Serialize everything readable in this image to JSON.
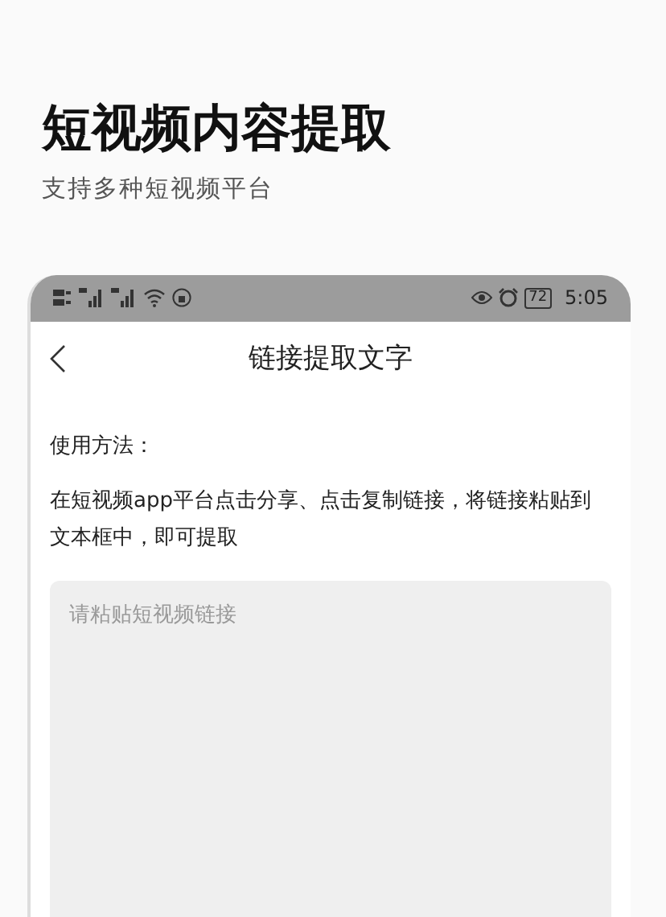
{
  "header": {
    "title": "短视频内容提取",
    "subtitle": "支持多种短视频平台"
  },
  "status_bar": {
    "battery": "72",
    "time": "5:05"
  },
  "nav_bar": {
    "title": "链接提取文字"
  },
  "usage": {
    "label": "使用方法：",
    "text": "在短视频app平台点击分享、点击复制链接，将链接粘贴到文本框中，即可提取"
  },
  "link_field": {
    "placeholder": "请粘贴短视频链接"
  }
}
